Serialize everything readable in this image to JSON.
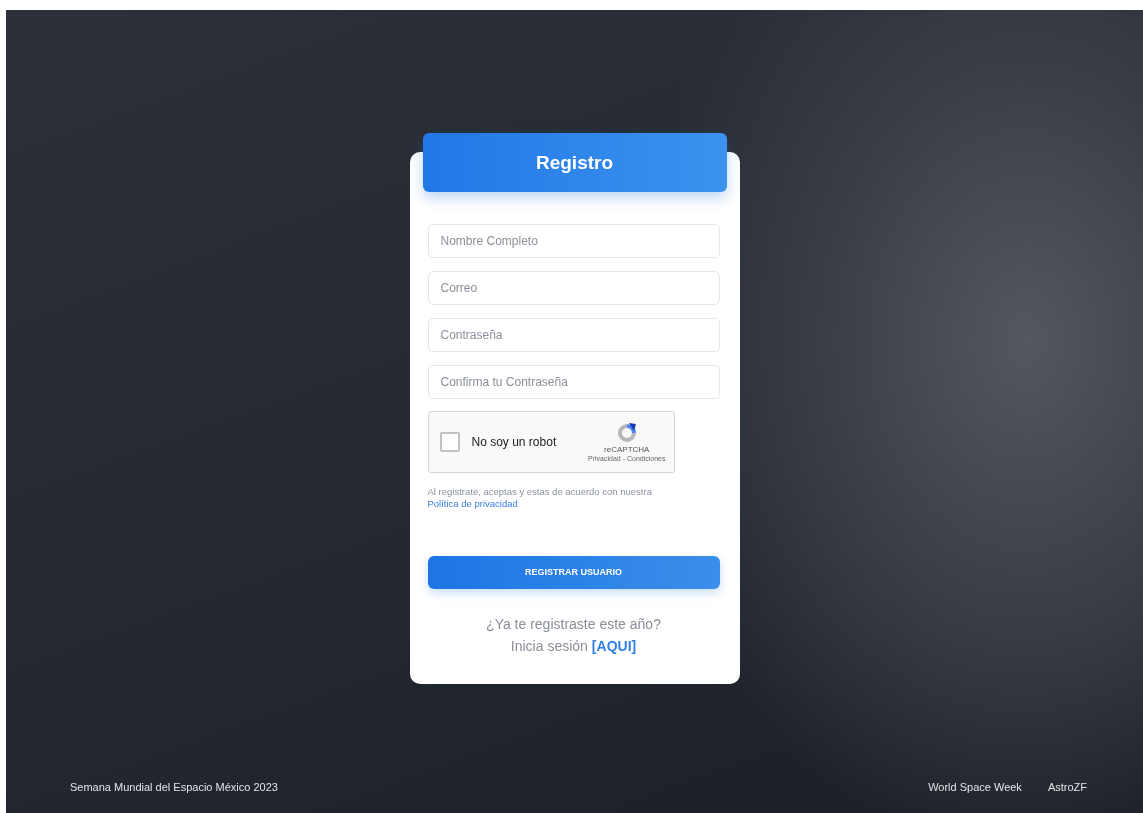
{
  "form": {
    "title": "Registro",
    "fields": [
      {
        "placeholder": "Nombre Completo"
      },
      {
        "placeholder": "Correo"
      },
      {
        "placeholder": "Contraseña"
      },
      {
        "placeholder": "Confirma tu Contraseña"
      }
    ],
    "captcha": {
      "label": "No soy un robot",
      "checked": false,
      "brand": "reCAPTCHA",
      "links": "Privacidad - Condiciones"
    },
    "terms": {
      "text": "Al registrate, aceptas y estas de acuerdo con nuestra",
      "link": "Política de privacidad"
    },
    "submit": "REGISTRAR USUARIO",
    "login_prompt": "¿Ya te registraste este año?",
    "login_text": "Inicia sesión",
    "login_link": "[AQUI]"
  },
  "footer": {
    "left": "Semana Mundial del Espacio México 2023",
    "links": [
      "World Space Week",
      "AstroZF"
    ]
  }
}
